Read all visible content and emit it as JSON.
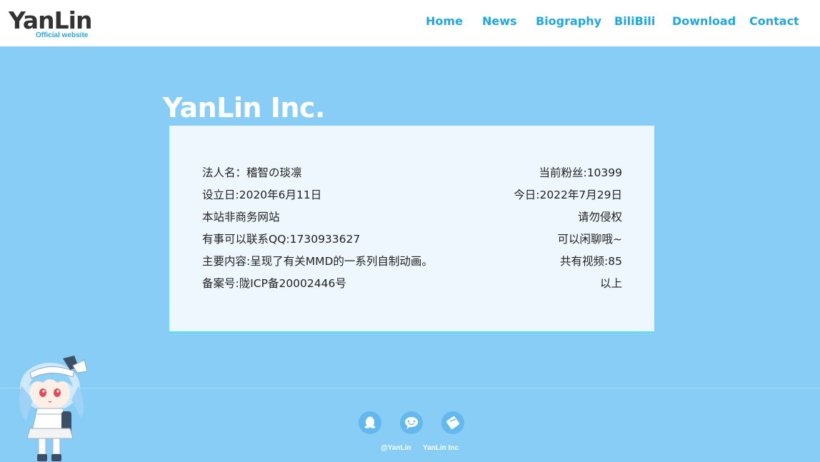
{
  "header": {
    "logo_text": "YanLin",
    "logo_subtitle": "Official website",
    "nav": [
      "Home",
      "News",
      "Biography",
      "BiliBili",
      "Download",
      "Contact"
    ]
  },
  "main": {
    "title": "YanLin Inc.",
    "rows": [
      {
        "left": "法人名：稽智の琰凛",
        "right": "当前粉丝:10399"
      },
      {
        "left": "设立日:2020年6月11日",
        "right": "今日:2022年7月29日"
      },
      {
        "left": "本站非商务网站",
        "right": "请勿侵权"
      },
      {
        "left": "有事可以联系QQ:1730933627",
        "right": "可以闲聊哦~"
      },
      {
        "left": "主要内容:呈现了有关MMD的一系列自制动画。",
        "right": "共有视频:85"
      },
      {
        "left": "备案号:陇ICP备20002446号",
        "right": "以上"
      }
    ]
  },
  "footer": {
    "icons": [
      "qq-icon",
      "wechat-icon",
      "bilibili-icon"
    ],
    "credit_1": "@YanLin",
    "credit_2": "YanLin Inc"
  },
  "colors": {
    "background": "#88cdf6",
    "nav_text": "#21a7e0",
    "card_bg": "#eef7fd",
    "card_border": "#4fe3ee",
    "icon_bg": "#63b8ee"
  }
}
